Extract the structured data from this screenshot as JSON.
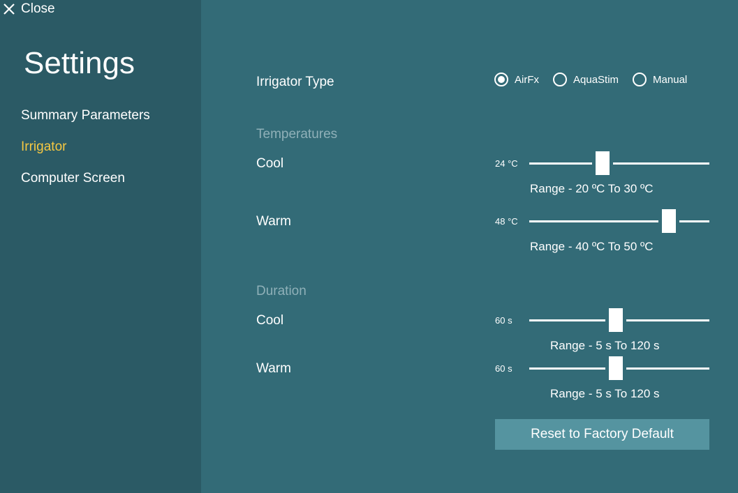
{
  "sidebar": {
    "close_label": "Close",
    "title": "Settings",
    "items": [
      {
        "label": "Summary Parameters",
        "active": false
      },
      {
        "label": "Irrigator",
        "active": true
      },
      {
        "label": "Computer Screen",
        "active": false
      }
    ]
  },
  "irrigator_type": {
    "label": "Irrigator Type",
    "options": [
      "AirFx",
      "AquaStim",
      "Manual"
    ],
    "selected": "AirFx"
  },
  "temperatures": {
    "heading": "Temperatures",
    "cool": {
      "label": "Cool",
      "value_text": "24 °C",
      "value": 24,
      "min": 20,
      "max": 30,
      "range_text": "Range - 20 ºC To 30 ºC"
    },
    "warm": {
      "label": "Warm",
      "value_text": "48 °C",
      "value": 48,
      "min": 40,
      "max": 50,
      "range_text": "Range - 40 ºC To 50 ºC"
    }
  },
  "duration": {
    "heading": "Duration",
    "cool": {
      "label": "Cool",
      "value_text": "60 s",
      "value": 60,
      "min": 5,
      "max": 120,
      "range_text": "Range - 5 s To 120 s"
    },
    "warm": {
      "label": "Warm",
      "value_text": "60 s",
      "value": 60,
      "min": 5,
      "max": 120,
      "range_text": "Range - 5 s To 120 s"
    }
  },
  "reset_label": "Reset to Factory Default",
  "colors": {
    "sidebar_bg": "#2b5a65",
    "main_bg": "#336b77",
    "active_nav": "#f5c842",
    "section_heading": "#8fb0b8",
    "button_bg": "#5594a0"
  }
}
